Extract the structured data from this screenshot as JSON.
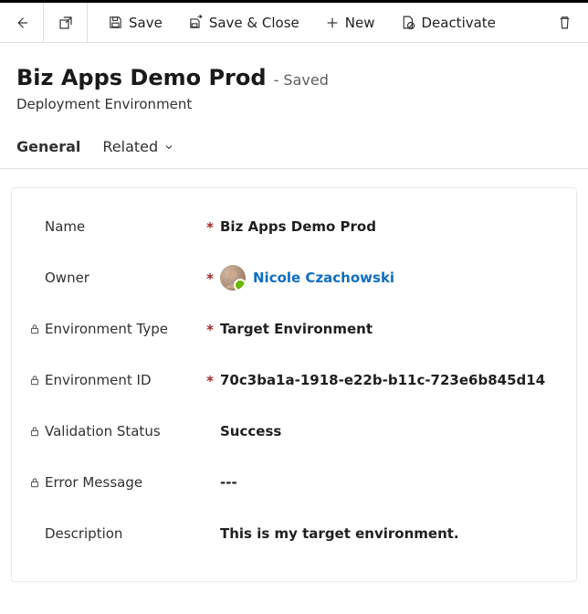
{
  "toolbar": {
    "save_label": "Save",
    "save_close_label": "Save & Close",
    "new_label": "New",
    "deactivate_label": "Deactivate"
  },
  "header": {
    "title": "Biz Apps Demo Prod",
    "saved_suffix": "- Saved",
    "entity": "Deployment Environment"
  },
  "tabs": {
    "general": "General",
    "related": "Related"
  },
  "form": {
    "name": {
      "label": "Name",
      "value": "Biz Apps Demo Prod",
      "required": true,
      "locked": false
    },
    "owner": {
      "label": "Owner",
      "value": "Nicole Czachowski",
      "required": true,
      "locked": false
    },
    "env_type": {
      "label": "Environment Type",
      "value": "Target Environment",
      "required": true,
      "locked": true
    },
    "env_id": {
      "label": "Environment ID",
      "value": "70c3ba1a-1918-e22b-b11c-723e6b845d14",
      "required": true,
      "locked": true
    },
    "validation": {
      "label": "Validation Status",
      "value": "Success",
      "required": false,
      "locked": true
    },
    "error": {
      "label": "Error Message",
      "value": "---",
      "required": false,
      "locked": true
    },
    "description": {
      "label": "Description",
      "value": "This is my target environment.",
      "required": false,
      "locked": false
    }
  }
}
